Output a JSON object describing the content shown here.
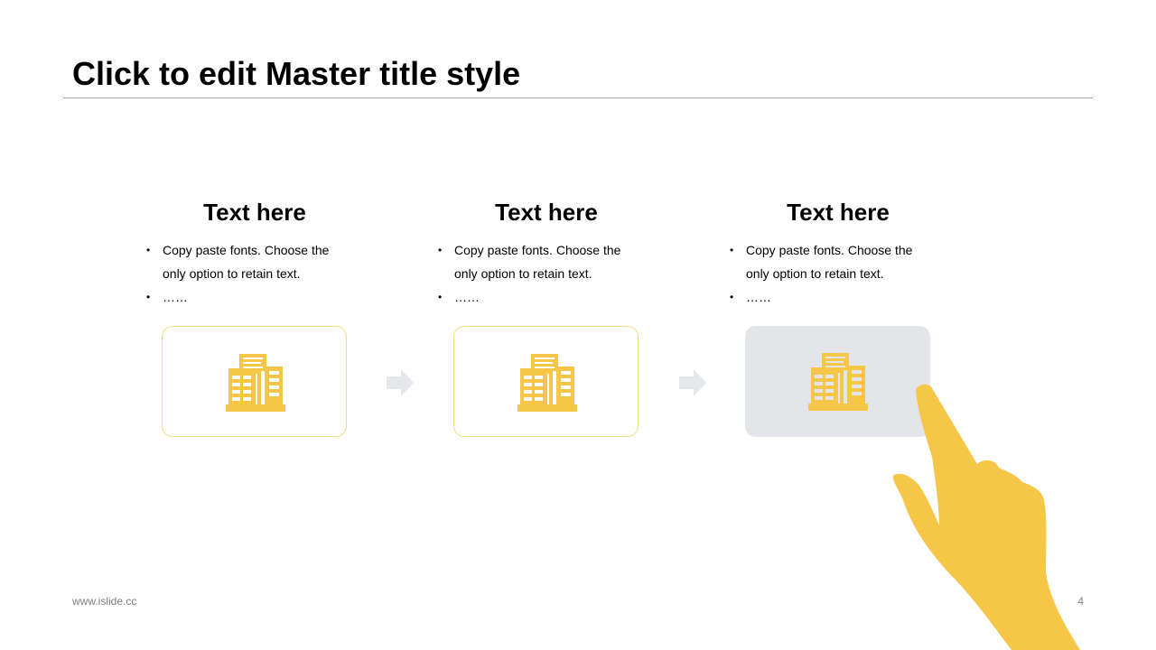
{
  "slide": {
    "title": "Click to edit Master title style"
  },
  "steps": [
    {
      "heading": "Text here",
      "bullets": [
        "Copy paste fonts. Choose the only option to retain text.",
        "……"
      ],
      "icon": "building-icon",
      "highlighted": false
    },
    {
      "heading": "Text here",
      "bullets": [
        "Copy paste fonts. Choose the only option to retain text.",
        "……"
      ],
      "icon": "building-icon",
      "highlighted": false
    },
    {
      "heading": "Text here",
      "bullets": [
        "Copy paste fonts. Choose the only option to retain text.",
        "……"
      ],
      "icon": "building-icon",
      "highlighted": true
    }
  ],
  "connectors": [
    "arrow-right-icon",
    "arrow-right-icon"
  ],
  "decoration": {
    "pointer": "pointing-hand-icon"
  },
  "footer": {
    "url": "www.islide.cc",
    "page_number": "4"
  },
  "colors": {
    "accent": "#F5C647",
    "card_border": "#F5DD85",
    "highlight_card": "#E4E5E9",
    "arrow": "#E6E7EB",
    "rule": "#A6A6A6",
    "footer_text": "#7F7F7F"
  }
}
